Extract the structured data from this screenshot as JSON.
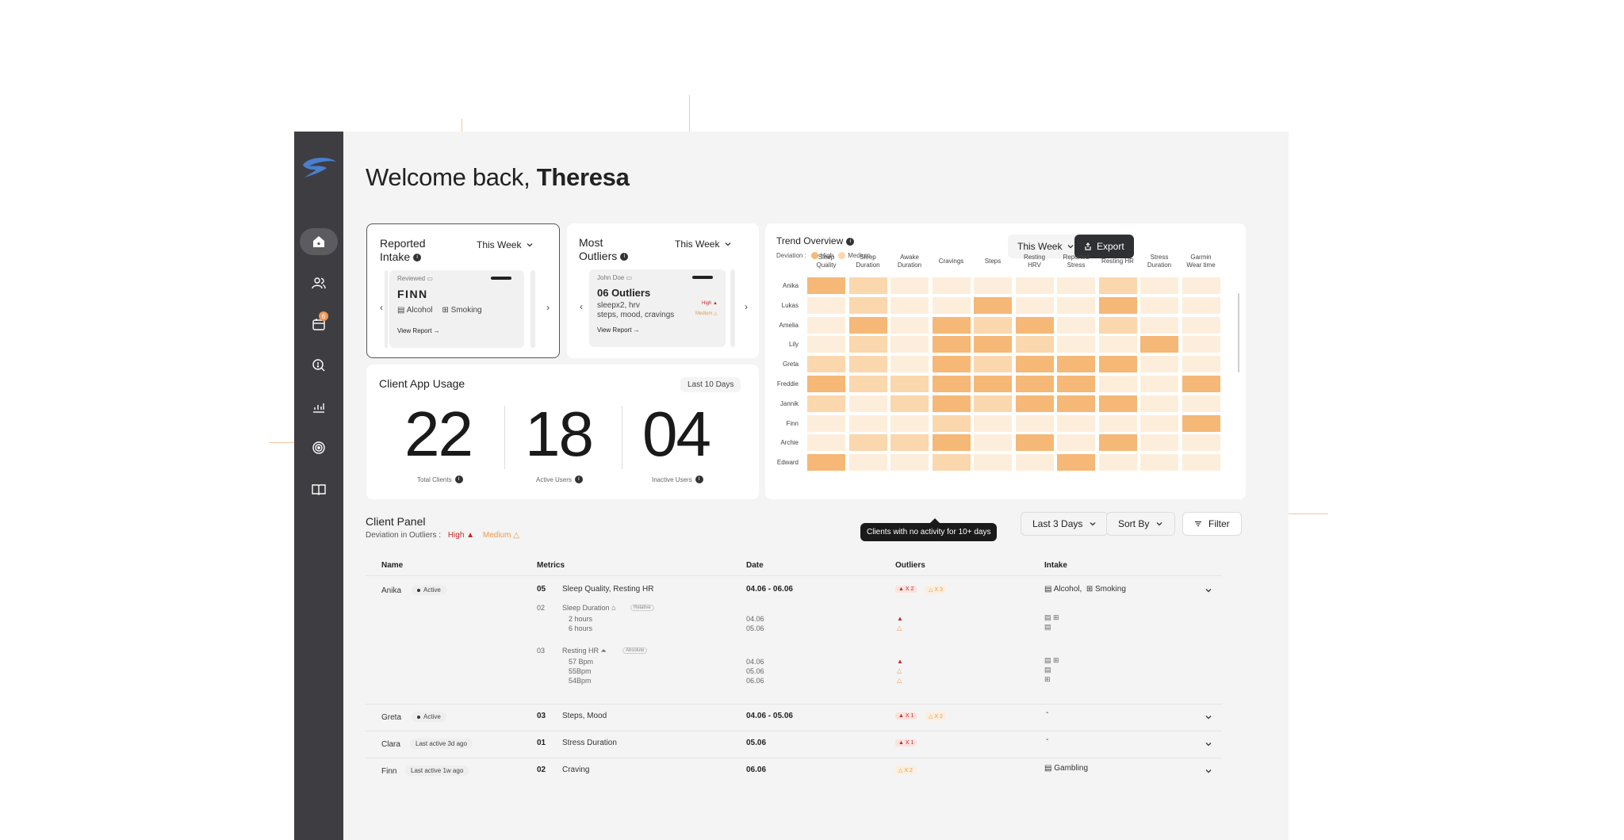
{
  "welcome": {
    "prefix": "Welcome back, ",
    "name": "Theresa"
  },
  "colors": {
    "sidebar": "#3e3e42",
    "high": "#c62828",
    "medium": "#e89a4b",
    "accent": "#f0965a",
    "heat_high": "#f5b877",
    "heat_mid": "#fad7ad",
    "heat_low": "#fdeedc"
  },
  "nav": {
    "badge": "6",
    "items": [
      "home-icon",
      "users-icon",
      "calendar-icon",
      "search-icon",
      "chart-icon",
      "target-icon",
      "book-icon"
    ]
  },
  "reported_intake": {
    "title_line1": "Reported",
    "title_line2": "Intake",
    "period": "This Week",
    "card": {
      "status": "Reviewed",
      "client": "FINN",
      "items": [
        "Alcohol",
        "Smoking"
      ],
      "link": "View Report"
    }
  },
  "most_outliers": {
    "title_line1": "Most",
    "title_line2": "Outliers",
    "period": "This Week",
    "card": {
      "client": "John Doe",
      "headline": "06 Outliers",
      "line1": "sleepx2, hrv",
      "line2": "steps, mood, cravings",
      "high": "High",
      "medium": "Medium",
      "link": "View Report"
    }
  },
  "app_usage": {
    "title": "Client App Usage",
    "period": "Last 10 Days",
    "stats": [
      {
        "value": "22",
        "label": "Total Clients"
      },
      {
        "value": "18",
        "label": "Active Users"
      },
      {
        "value": "04",
        "label": "Inactive Users"
      }
    ]
  },
  "trend": {
    "title": "Trend Overview",
    "deviation_label": "Deviation :",
    "legend_high": "High",
    "legend_medium": "Medium",
    "period": "This Week",
    "export": "Export",
    "columns": [
      [
        "Sleep",
        "Quality"
      ],
      [
        "Sleep",
        "Duration"
      ],
      [
        "Awake",
        "Duration"
      ],
      [
        "Cravings",
        ""
      ],
      [
        "Steps",
        ""
      ],
      [
        "Resting",
        "HRV"
      ],
      [
        "Reported",
        "Stress"
      ],
      [
        "Resting HR",
        ""
      ],
      [
        "Stress",
        "Duration"
      ],
      [
        "Garmin",
        "Wear time"
      ]
    ],
    "rows": [
      "Anika",
      "Lukas",
      "Amelia",
      "Lily",
      "Greta",
      "Freddie",
      "Jannik",
      "Finn",
      "Archie",
      "Edward"
    ],
    "levels": [
      [
        3,
        2,
        1,
        1,
        1,
        1,
        1,
        2,
        1,
        1
      ],
      [
        1,
        2,
        1,
        1,
        3,
        1,
        1,
        3,
        1,
        1
      ],
      [
        1,
        3,
        1,
        3,
        2,
        3,
        1,
        2,
        1,
        1
      ],
      [
        1,
        2,
        1,
        3,
        3,
        2,
        1,
        1,
        3,
        1
      ],
      [
        2,
        2,
        1,
        3,
        2,
        3,
        3,
        3,
        1,
        1
      ],
      [
        3,
        2,
        2,
        3,
        3,
        3,
        3,
        1,
        1,
        3
      ],
      [
        2,
        1,
        2,
        3,
        2,
        3,
        3,
        3,
        1,
        1
      ],
      [
        1,
        1,
        1,
        2,
        1,
        1,
        1,
        1,
        1,
        3
      ],
      [
        1,
        2,
        2,
        3,
        1,
        3,
        1,
        3,
        1,
        1
      ],
      [
        3,
        1,
        1,
        2,
        1,
        1,
        3,
        1,
        1,
        1
      ]
    ]
  },
  "panel": {
    "title": "Client Panel",
    "deviation_label": "Deviation in Outliers :",
    "legend_high": "High",
    "legend_medium": "Medium",
    "tooltip": "Clients with no activity for 10+ days",
    "filters": {
      "range": "Last 3 Days",
      "sort": "Sort By",
      "filter": "Filter"
    },
    "headers": [
      "Name",
      "Metrics",
      "Date",
      "Outliers",
      "Intake"
    ],
    "rows": [
      {
        "name": "Anika",
        "status": "Active",
        "count": "05",
        "metrics": "Sleep Quality, Resting HR",
        "date": "04.06 - 06.06",
        "high": "X 2",
        "medium": "X 3",
        "intake": "Alcohol,",
        "intake2": "Smoking",
        "details": [
          {
            "count": "02",
            "metric": "Sleep Duration",
            "tag": "Relative",
            "values": [
              "2 hours",
              "6 hours"
            ],
            "dates": [
              "04.06",
              "05.06"
            ]
          },
          {
            "count": "03",
            "metric": "Resting HR",
            "tag": "Absolute",
            "values": [
              "57 Bpm",
              "55Bpm",
              "54Bpm"
            ],
            "dates": [
              "04.06",
              "05.06",
              "06.06"
            ]
          }
        ]
      },
      {
        "name": "Greta",
        "status": "Active",
        "count": "03",
        "metrics": "Steps, Mood",
        "date": "04.06 - 05.06",
        "high": "X 1",
        "medium": "X 2",
        "intake": "-"
      },
      {
        "name": "Clara",
        "status": "Last active 3d ago",
        "count": "01",
        "metrics": "Stress Duration",
        "date": "05.06",
        "high": "X 1",
        "intake": "-"
      },
      {
        "name": "Finn",
        "status": "Last active 1w ago",
        "count": "02",
        "metrics": "Craving",
        "date": "06.06",
        "medium": "X 2",
        "intake": "Gambling"
      }
    ]
  }
}
